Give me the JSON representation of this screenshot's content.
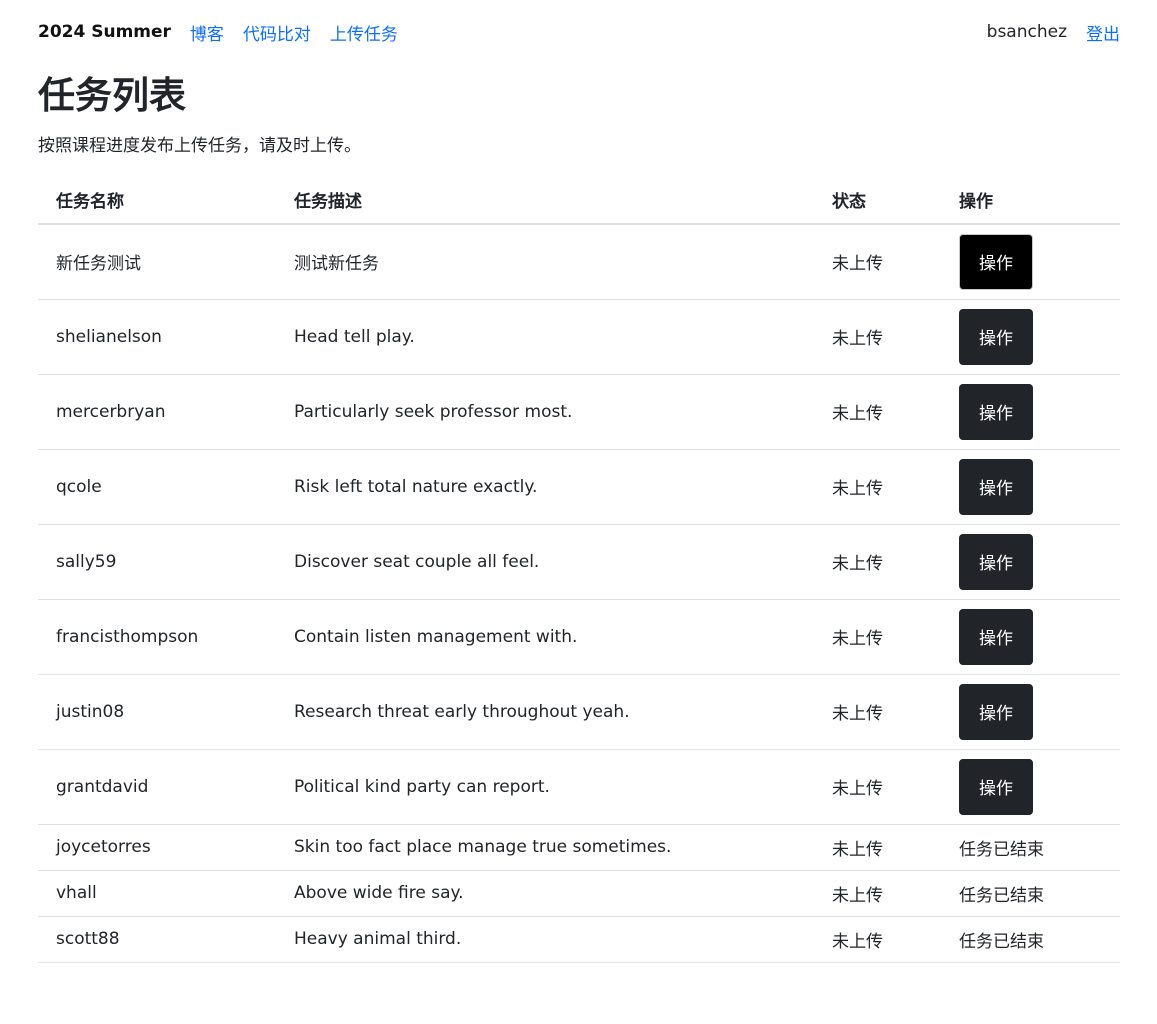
{
  "navbar": {
    "brand": "2024 Summer",
    "links": [
      "博客",
      "代码比对",
      "上传任务"
    ],
    "username": "bsanchez",
    "logout_label": "登出"
  },
  "page": {
    "title": "任务列表",
    "description": "按照课程进度发布上传任务，请及时上传。"
  },
  "table": {
    "headers": [
      "任务名称",
      "任务描述",
      "状态",
      "操作"
    ],
    "rows": [
      {
        "name": "新任务测试",
        "description": "测试新任务",
        "status": "未上传",
        "action": "操作"
      },
      {
        "name": "shelianelson",
        "description": "Head tell play.",
        "status": "未上传",
        "action": "操作"
      },
      {
        "name": "mercerbryan",
        "description": "Particularly seek professor most.",
        "status": "未上传",
        "action": "操作"
      },
      {
        "name": "qcole",
        "description": "Risk left total nature exactly.",
        "status": "未上传",
        "action": "操作"
      },
      {
        "name": "sally59",
        "description": "Discover seat couple all feel.",
        "status": "未上传",
        "action": "操作"
      },
      {
        "name": "francisthompson",
        "description": "Contain listen management with.",
        "status": "未上传",
        "action": "操作"
      },
      {
        "name": "justin08",
        "description": "Research threat early throughout yeah.",
        "status": "未上传",
        "action": "操作"
      },
      {
        "name": "grantdavid",
        "description": "Political kind party can report.",
        "status": "未上传",
        "action": "操作"
      },
      {
        "name": "joycetorres",
        "description": "Skin too fact place manage true sometimes.",
        "status": "未上传",
        "action_text": "任务已结束"
      },
      {
        "name": "vhall",
        "description": "Above wide fire say.",
        "status": "未上传",
        "action_text": "任务已结束"
      },
      {
        "name": "scott88",
        "description": "Heavy animal third.",
        "status": "未上传",
        "action_text": "任务已结束"
      }
    ]
  },
  "colors": {
    "link": "#0d6efd",
    "button_dark": "#212529",
    "button_focused": "#000000",
    "border": "#dee2e6"
  }
}
